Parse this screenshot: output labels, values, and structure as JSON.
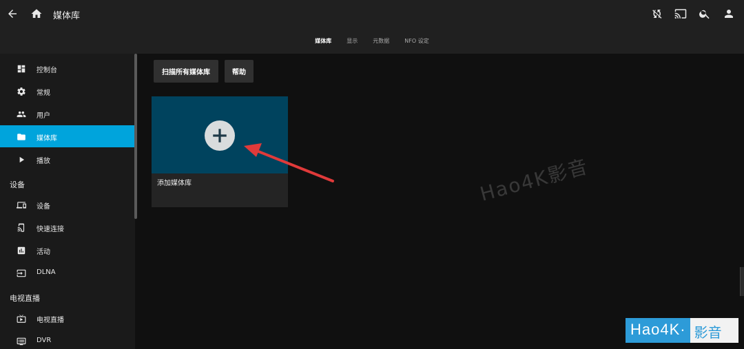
{
  "header": {
    "title": "媒体库",
    "tabs": [
      "媒体库",
      "显示",
      "元数据",
      "NFO 设定"
    ],
    "active_tab": 0
  },
  "sidebar": {
    "items_top": [
      {
        "label": "控制台",
        "icon": "dashboard-icon"
      },
      {
        "label": "常规",
        "icon": "gear-icon"
      },
      {
        "label": "用户",
        "icon": "users-icon"
      },
      {
        "label": "媒体库",
        "icon": "folder-icon",
        "active": true
      },
      {
        "label": "播放",
        "icon": "play-icon"
      }
    ],
    "section_devices": "设备",
    "items_devices": [
      {
        "label": "设备",
        "icon": "devices-icon"
      },
      {
        "label": "快速连接",
        "icon": "cast-phone-icon"
      },
      {
        "label": "活动",
        "icon": "activity-icon"
      },
      {
        "label": "DLNA",
        "icon": "input-icon"
      }
    ],
    "section_livetv": "电视直播",
    "items_livetv": [
      {
        "label": "电视直播",
        "icon": "live-tv-icon"
      },
      {
        "label": "DVR",
        "icon": "dvr-icon"
      }
    ]
  },
  "toolbar": {
    "scan_label": "扫描所有媒体库",
    "help_label": "帮助"
  },
  "add_card": {
    "label": "添加媒体库"
  },
  "watermark": "Hao4K影音",
  "logo": {
    "part1": "Hao4K·",
    "part2": "影音"
  },
  "colors": {
    "accent": "#00a4dc",
    "card": "#00435e",
    "arrow": "#e03a3a"
  }
}
